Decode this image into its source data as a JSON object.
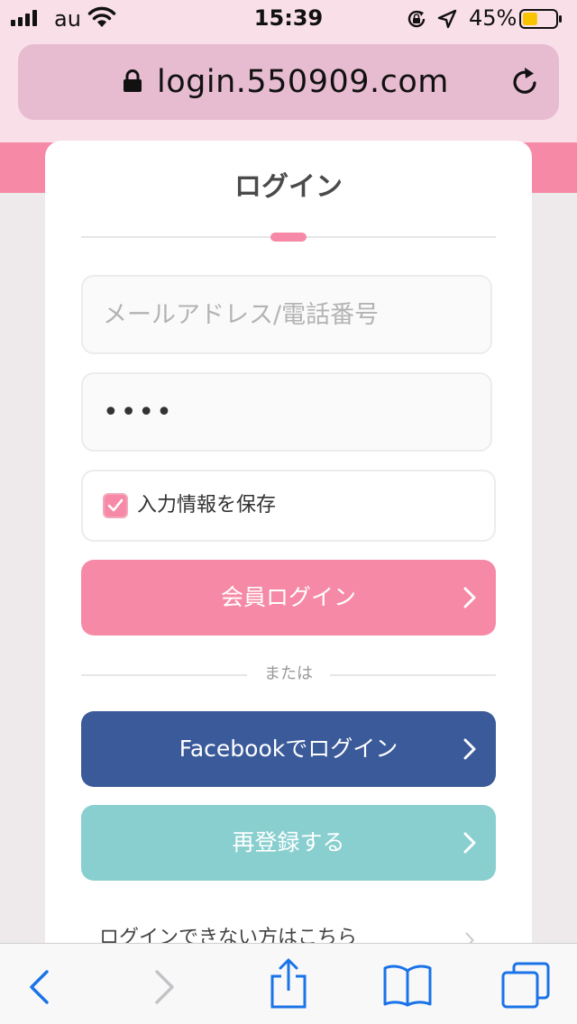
{
  "status_bar": {
    "carrier": "au",
    "time": "15:39",
    "battery_percent": "45%",
    "battery_level": 0.45
  },
  "browser": {
    "url": "login.550909.com"
  },
  "login_card": {
    "title": "ログイン",
    "email_placeholder": "メールアドレス/電話番号",
    "password_value": "••••",
    "remember_label": "入力情報を保存",
    "remember_checked": true,
    "login_button": "会員ログイン",
    "divider_text": "または",
    "facebook_button": "Facebookでログイン",
    "register_button": "再登録する",
    "trouble_link": "ログインできない方はこちら"
  },
  "colors": {
    "accent_pink": "#f68aa6",
    "facebook_blue": "#3b5a9a",
    "register_teal": "#89cfcf",
    "ios_blue": "#1a73e8"
  },
  "icons": {
    "lock": "lock-icon",
    "reload": "reload-icon",
    "back": "chevron-left-icon",
    "forward": "chevron-right-icon",
    "share": "share-icon",
    "bookmarks": "book-icon",
    "tabs": "tabs-icon"
  }
}
